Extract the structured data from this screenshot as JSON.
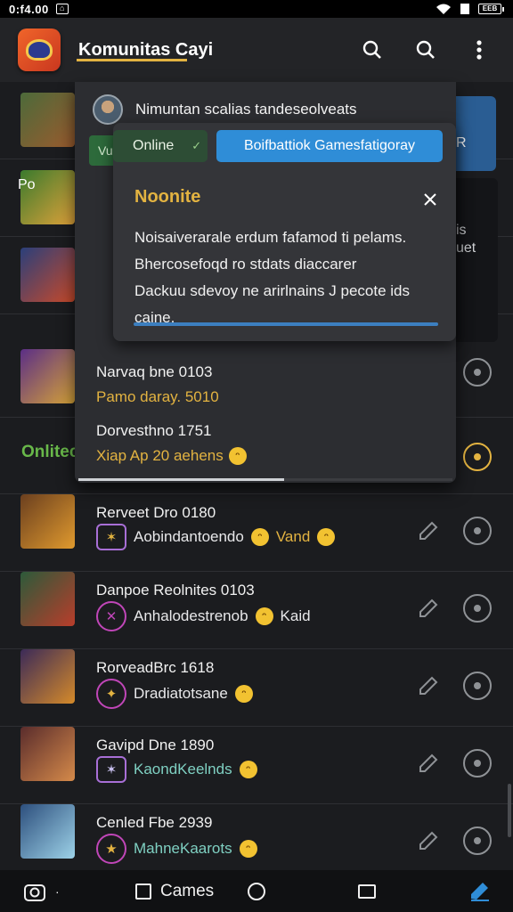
{
  "status_bar": {
    "time": "0:f4.00",
    "battery": "EEB"
  },
  "app_bar": {
    "title": "Komunitas Cayi"
  },
  "dropdown": {
    "username": "Nimuntan scalias tandeseolveats",
    "progress": 0.55,
    "online_label": "Online",
    "blue_button": "Boifbattiok Gamesfatigoray",
    "side_tag": "Vu"
  },
  "notice": {
    "title": "Noonite",
    "lines": [
      "Noisaiverarale erdum fafamod ti pelams.",
      "Bhercosefoqd ro stdats diaccarer",
      "Dackuu sdevoy ne arirlnains J pecote ids",
      "caine."
    ]
  },
  "side_texts": {
    "right_r": "R",
    "right_s": "is",
    "right_uet": "uet",
    "left_po": "Po"
  },
  "list": [
    {
      "title": "",
      "sub": "",
      "thumb": [
        "#4c6a3a",
        "#9a5b2e"
      ]
    },
    {
      "title": "",
      "sub": "",
      "thumb": [
        "#3a7a2d",
        "#e0a23a"
      ]
    },
    {
      "title": "",
      "sub": "",
      "thumb": [
        "#2a3f7a",
        "#c94a2a"
      ]
    },
    {
      "title": "Narvaq bne 0103",
      "sub": "Pamo daray. 5010",
      "thumb": [
        "#5b2e86",
        "#d6a338"
      ]
    },
    {
      "title": "Dorvesthno 1751",
      "sub": "Xiap Ap 20 aehens",
      "online": "Onlitec"
    },
    {
      "title": "Rerveet Dro 0180",
      "sub": "Aobindantoendo",
      "tag": "Vand",
      "thumb": [
        "#6b3f1f",
        "#e09a2e"
      ]
    },
    {
      "title": "Danpoe Reolnites 0103",
      "sub": "Anhalodestrenob",
      "tag": "Kaid",
      "thumb": [
        "#2c5a3a",
        "#b93d2b"
      ]
    },
    {
      "title": "RorveadBrc 1618",
      "sub": "Dradiatotsane",
      "tag": "",
      "thumb": [
        "#3b2a58",
        "#d58a2a"
      ]
    },
    {
      "title": "Gavipd Dne 1890",
      "sub": "KaondKeelnds",
      "tag": "",
      "thumb": [
        "#5a2c2c",
        "#d58a4a"
      ]
    },
    {
      "title": "Cenled Fbe 2939",
      "sub": "MahneKaarots",
      "tag": "",
      "thumb": [
        "#2d4f7d",
        "#9dd2e8"
      ]
    }
  ],
  "bottom_nav": {
    "games_label": "Cames"
  },
  "colors": {
    "accent_gold": "#e3b341",
    "online_green": "#69b84a",
    "blue": "#2f8dd7"
  }
}
